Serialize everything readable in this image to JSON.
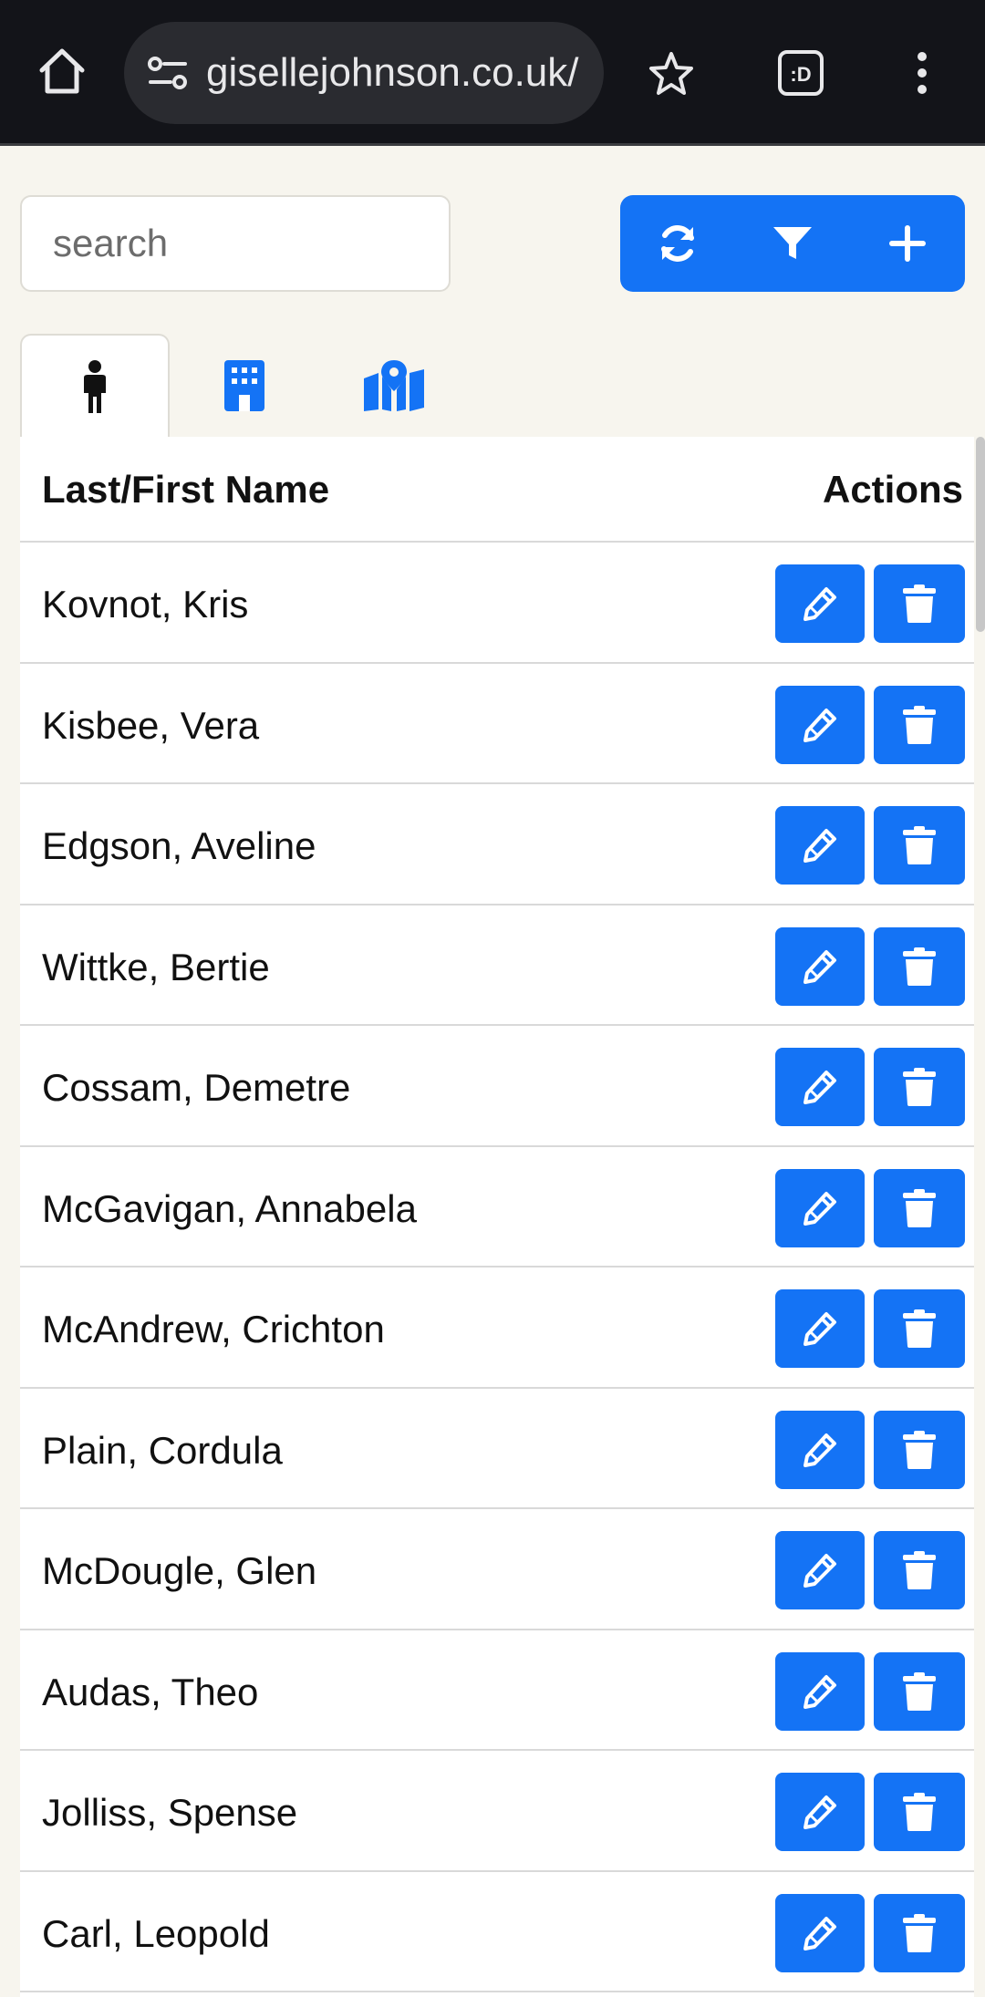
{
  "browser": {
    "url": "gisellejohnson.co.uk/",
    "icons": [
      "home-icon",
      "site-settings-icon",
      "star-icon",
      "extension-icon",
      "more-vert-icon"
    ]
  },
  "toolbar": {
    "search_placeholder": "search",
    "buttons": [
      "refresh-icon",
      "filter-icon",
      "plus-icon"
    ]
  },
  "tabs": [
    {
      "icon": "person-icon",
      "active": true
    },
    {
      "icon": "building-icon",
      "active": false
    },
    {
      "icon": "map-icon",
      "active": false
    }
  ],
  "table": {
    "col_name": "Last/First Name",
    "col_actions": "Actions",
    "rows": [
      "Kovnot, Kris",
      "Kisbee, Vera",
      "Edgson, Aveline",
      "Wittke, Bertie",
      "Cossam, Demetre",
      "McGavigan, Annabela",
      "McAndrew, Crichton",
      "Plain, Cordula",
      "McDougle, Glen",
      "Audas, Theo",
      "Jolliss, Spense",
      "Carl, Leopold"
    ]
  },
  "colors": {
    "accent": "#1473f5",
    "page_bg": "#f7f5ee",
    "chrome_bg": "#131419"
  }
}
